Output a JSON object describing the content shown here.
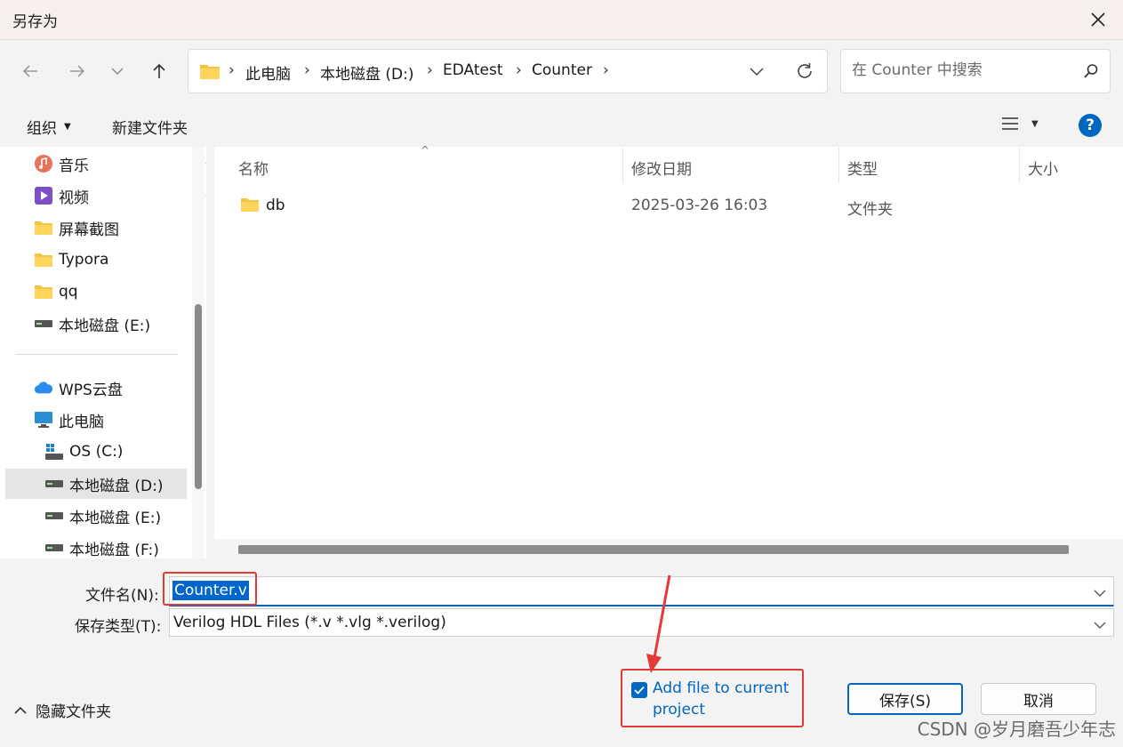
{
  "window": {
    "title": "另存为"
  },
  "breadcrumb": [
    "此电脑",
    "本地磁盘 (D:)",
    "EDAtest",
    "Counter"
  ],
  "search": {
    "placeholder": "在 Counter 中搜索"
  },
  "toolbar": {
    "organize_label": "组织",
    "new_folder_label": "新建文件夹"
  },
  "sidebar": {
    "items": [
      {
        "label": "音乐",
        "icon": "music-icon",
        "pinned": true
      },
      {
        "label": "视频",
        "icon": "video-icon",
        "pinned": true
      },
      {
        "label": "屏幕截图",
        "icon": "folder-icon"
      },
      {
        "label": "Typora",
        "icon": "folder-icon"
      },
      {
        "label": "qq",
        "icon": "folder-icon"
      },
      {
        "label": "本地磁盘 (E:)",
        "icon": "drive-icon"
      },
      {
        "label": "WPS云盘",
        "icon": "cloud-icon"
      },
      {
        "label": "此电脑",
        "icon": "computer-icon"
      },
      {
        "label": "OS (C:)",
        "icon": "windows-drive-icon"
      },
      {
        "label": "本地磁盘 (D:)",
        "icon": "drive-icon",
        "selected": true
      },
      {
        "label": "本地磁盘 (E:)",
        "icon": "drive-icon"
      },
      {
        "label": "本地磁盘 (F:)",
        "icon": "drive-icon"
      }
    ]
  },
  "file_list": {
    "columns": [
      "名称",
      "修改日期",
      "类型",
      "大小"
    ],
    "rows": [
      {
        "name": "db",
        "modified": "2025-03-26 16:03",
        "type": "文件夹",
        "size": ""
      }
    ]
  },
  "form": {
    "filename_label": "文件名(N):",
    "filename_value": "Counter.v",
    "filetype_label": "保存类型(T):",
    "filetype_value": "Verilog HDL Files (*.v *.vlg *.verilog)"
  },
  "footer": {
    "hide_folders_label": "隐藏文件夹",
    "checkbox_label": "Add file to current project",
    "checkbox_checked": true,
    "save_label": "保存(S)",
    "cancel_label": "取消"
  },
  "watermark": "CSDN @岁月磨吾少年志",
  "colors": {
    "accent": "#0067c0",
    "annotation": "#e53935"
  }
}
